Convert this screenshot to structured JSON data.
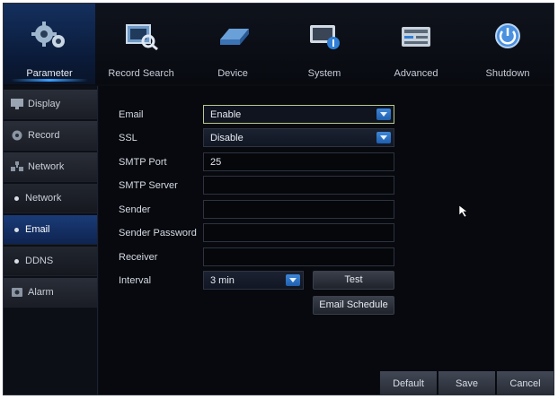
{
  "topbar": {
    "tabs": [
      {
        "label": "Parameter",
        "icon": "gears-icon",
        "active": true
      },
      {
        "label": "Record Search",
        "icon": "record-search-icon",
        "active": false
      },
      {
        "label": "Device",
        "icon": "hard-drive-icon",
        "active": false
      },
      {
        "label": "System",
        "icon": "system-icon",
        "active": false
      },
      {
        "label": "Advanced",
        "icon": "advanced-icon",
        "active": false
      },
      {
        "label": "Shutdown",
        "icon": "power-icon",
        "active": false
      }
    ]
  },
  "sidebar": {
    "items": [
      {
        "label": "Display",
        "icon": "display-icon"
      },
      {
        "label": "Record",
        "icon": "record-icon"
      },
      {
        "label": "Network",
        "icon": "network-icon"
      },
      {
        "label": "Network",
        "icon": "bullet-icon"
      },
      {
        "label": "Email",
        "icon": "bullet-icon"
      },
      {
        "label": "DDNS",
        "icon": "bullet-icon"
      },
      {
        "label": "Alarm",
        "icon": "alarm-icon"
      }
    ]
  },
  "form": {
    "email_label": "Email",
    "email_value": "Enable",
    "ssl_label": "SSL",
    "ssl_value": "Disable",
    "smtp_port_label": "SMTP Port",
    "smtp_port_value": "25",
    "smtp_server_label": "SMTP Server",
    "smtp_server_value": "",
    "sender_label": "Sender",
    "sender_value": "",
    "sender_password_label": "Sender Password",
    "sender_password_value": "",
    "receiver_label": "Receiver",
    "receiver_value": "",
    "interval_label": "Interval",
    "interval_value": "3 min",
    "test_button": "Test",
    "email_schedule_button": "Email Schedule"
  },
  "footer": {
    "default_button": "Default",
    "save_button": "Save",
    "cancel_button": "Cancel"
  },
  "colors": {
    "accent": "#1f5fae",
    "active_tab": "#14305e",
    "background": "#07090e"
  }
}
